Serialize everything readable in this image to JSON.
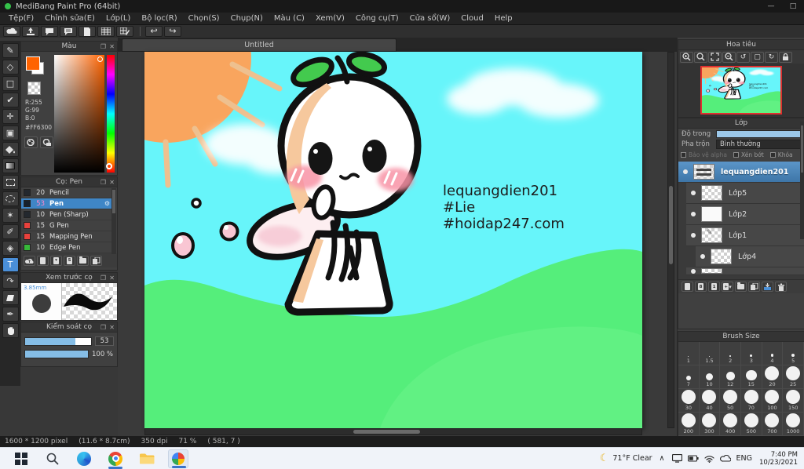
{
  "window": {
    "title": "MediBang Paint Pro (64bit)",
    "minimize": "—",
    "maximize": "□"
  },
  "menu": {
    "items": [
      "Tệp(F)",
      "Chỉnh sửa(E)",
      "Lớp(L)",
      "Bộ lọc(R)",
      "Chọn(S)",
      "Chụp(N)",
      "Màu (C)",
      "Xem(V)",
      "Công cụ(T)",
      "Cửa sổ(W)",
      "Cloud",
      "Help"
    ]
  },
  "tab": {
    "title": "Untitled"
  },
  "icons": {
    "undo": "↩",
    "redo": "↪",
    "gear": "⚙",
    "close": "✕",
    "popout": "❐",
    "rotate_left": "↺",
    "rotate_right": "↻",
    "frame": "▢",
    "chevron_up": "∧",
    "moon": "☾"
  },
  "color_panel": {
    "title": "Màu",
    "r": "R:255",
    "g": "G:99",
    "b": "B:0",
    "hex": "#FF6300"
  },
  "brush_panel": {
    "title": "Cọ: Pen",
    "brushes": [
      {
        "size": "20",
        "name": "Pencil",
        "swatch": "#23282e",
        "selected": false
      },
      {
        "size": "53",
        "name": "Pen",
        "swatch": "#16202c",
        "selected": true
      },
      {
        "size": "10",
        "name": "Pen (Sharp)",
        "swatch": "#23282e",
        "selected": false
      },
      {
        "size": "15",
        "name": "G Pen",
        "swatch": "#e8413c",
        "selected": false
      },
      {
        "size": "15",
        "name": "Mapping Pen",
        "swatch": "#e8413c",
        "selected": false
      },
      {
        "size": "10",
        "name": "Edge Pen",
        "swatch": "#37b83a",
        "selected": false
      }
    ]
  },
  "preview_panel": {
    "title": "Xem trước cọ",
    "size_label": "3.85mm"
  },
  "control_panel": {
    "title": "Kiểm soát cọ",
    "size_value": "53",
    "opacity_value": "100 %"
  },
  "navigator": {
    "title": "Hoa tiêu"
  },
  "layers": {
    "title": "Lớp",
    "opacity_label": "Độ trong",
    "blend_label": "Pha trộn",
    "blend_value": "Bình thường",
    "alpha_label": "Bảo vệ alpha",
    "clip_label": "Xén bớt",
    "lock_label": "Khóa",
    "items": [
      {
        "name": "lequangdien201",
        "selected": true,
        "thumb": "text"
      },
      {
        "name": "Lớp5",
        "thumb": "checker"
      },
      {
        "name": "Lớp2",
        "thumb": "white"
      },
      {
        "name": "Lớp1",
        "thumb": "sketch"
      },
      {
        "name": "Lớp4",
        "thumb": "checker",
        "indent": true
      }
    ],
    "partial_row": true
  },
  "brush_size": {
    "title": "Brush Size",
    "sizes": [
      "1",
      "1.5",
      "2",
      "3",
      "4",
      "5",
      "7",
      "10",
      "12",
      "15",
      "20",
      "25",
      "30",
      "40",
      "50",
      "70",
      "100",
      "150",
      "200",
      "300",
      "400",
      "500",
      "700",
      "1000"
    ]
  },
  "canvas": {
    "texts": [
      "lequangdien201",
      "#Lie",
      "#hoidap247.com"
    ]
  },
  "status": {
    "dimensions": "1600 * 1200 pixel",
    "size_cm": "(11.6 * 8.7cm)",
    "dpi": "350 dpi",
    "zoom": "71 %",
    "coords": "( 581, 7 )"
  },
  "taskbar": {
    "weather": "71°F Clear",
    "lang": "ENG",
    "time": "7:40 PM",
    "date": "10/23/2021"
  }
}
